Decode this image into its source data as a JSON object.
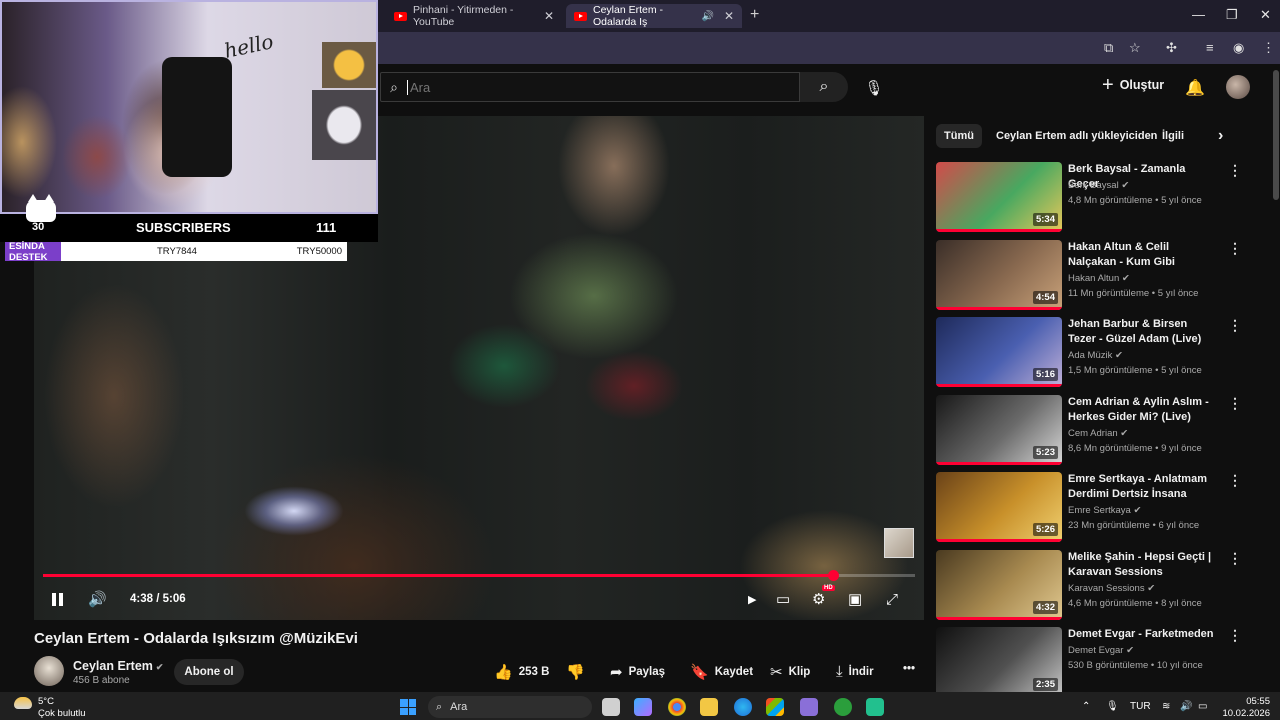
{
  "browser": {
    "tabs": [
      {
        "label": "Pinhani - Yitirmeden - YouTube",
        "active": false
      },
      {
        "label": "Ceylan Ertem - Odalarda Iş",
        "active": true
      }
    ]
  },
  "header": {
    "search_placeholder": "Ara",
    "create_label": "Oluştur"
  },
  "player": {
    "current_time": "4:38",
    "duration": "5:06",
    "time_display": "4:38 / 5:06",
    "progress_fraction": 0.906,
    "hd_badge": "HD"
  },
  "video": {
    "title": "Ceylan Ertem - Odalarda Işıksızım @MüzikEvi",
    "channel": "Ceylan Ertem",
    "subscribers": "456 B abone",
    "subscribe_label": "Abone ol",
    "actions": {
      "likes": "253 B",
      "share": "Paylaş",
      "save": "Kaydet",
      "clip": "Klip",
      "download": "İndir"
    }
  },
  "filters": [
    "Tümü",
    "Ceylan Ertem adlı yükleyiciden",
    "İlgili"
  ],
  "recommendations": [
    {
      "title": "Berk Baysal - Zamanla Geçer",
      "channel": "Berk Baysal",
      "views": "4,8 Mn görüntüleme",
      "age": "5 yıl önce",
      "duration": "5:34",
      "colors": [
        "#d34a4a",
        "#48a860",
        "#e8c85a"
      ]
    },
    {
      "title": "Hakan Altun & Celil Nalçakan - Kum Gibi",
      "channel": "Hakan Altun",
      "views": "11 Mn görüntüleme",
      "age": "5 yıl önce",
      "duration": "4:54",
      "colors": [
        "#3a2e28",
        "#8a6a50",
        "#c9a27a"
      ]
    },
    {
      "title": "Jehan Barbur & Birsen Tezer - Güzel Adam (Live)",
      "channel": "Ada Müzik",
      "views": "1,5 Mn görüntüleme",
      "age": "5 yıl önce",
      "duration": "5:16",
      "colors": [
        "#1e2a5a",
        "#4a5fb0",
        "#c0b0d8"
      ]
    },
    {
      "title": "Cem Adrian & Aylin Aslım - Herkes Gider Mi? (Live)",
      "channel": "Cem Adrian",
      "views": "8,6 Mn görüntüleme",
      "age": "9 yıl önce",
      "duration": "5:23",
      "colors": [
        "#181818",
        "#6a6a6a",
        "#d8d8d8"
      ]
    },
    {
      "title": "Emre Sertkaya - Anlatmam Derdimi Dertsiz İnsana",
      "channel": "Emre Sertkaya",
      "views": "23 Mn görüntüleme",
      "age": "6 yıl önce",
      "duration": "5:26",
      "colors": [
        "#6a4218",
        "#c8902a",
        "#f0d070"
      ]
    },
    {
      "title": "Melike Şahin - Hepsi Geçti | Karavan Sessions",
      "channel": "Karavan Sessions",
      "views": "4,6 Mn görüntüleme",
      "age": "8 yıl önce",
      "duration": "4:32",
      "colors": [
        "#4a3a20",
        "#a88a50",
        "#e0c890"
      ]
    },
    {
      "title": "Demet Evgar - Farketmeden",
      "channel": "Demet Evgar",
      "views": "530 B görüntüleme",
      "age": "10 yıl önce",
      "duration": "2:35",
      "colors": [
        "#101010",
        "#505050",
        "#c8c8c8"
      ]
    }
  ],
  "overlay": {
    "subscribers_label": "SUBSCRIBERS",
    "count_left": "30",
    "count_right": "111",
    "donation_label": "ESİNDA DESTEK",
    "donation_value_1": "TRY7844",
    "donation_value_2": "TRY50000",
    "wall_text": "hello"
  },
  "taskbar": {
    "temperature": "5°C",
    "weather": "Çok bulutlu",
    "search": "Ara",
    "language": "TUR",
    "time": "05:55",
    "date": "10.02.2026"
  }
}
